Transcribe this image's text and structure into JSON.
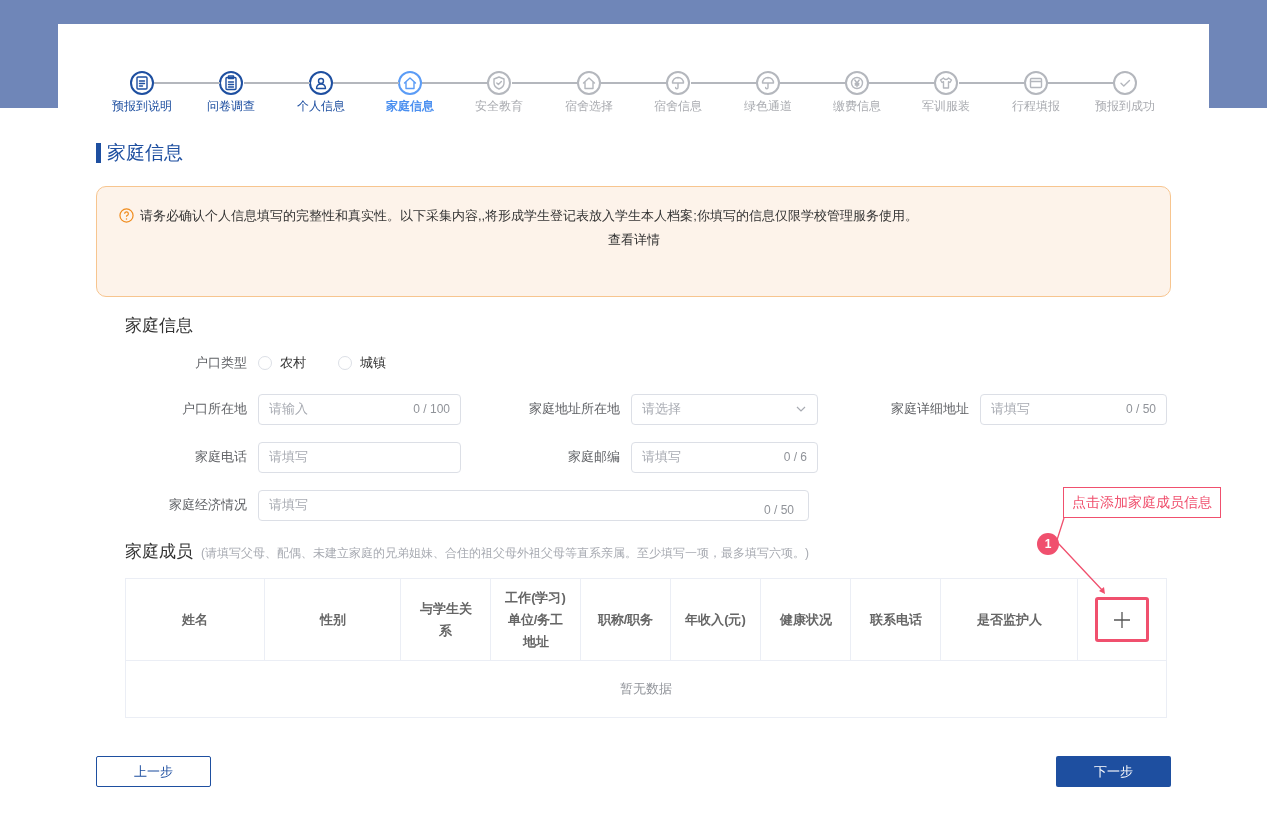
{
  "steps": [
    {
      "label": "预报到说明",
      "done": true,
      "selected": false,
      "kind": "document"
    },
    {
      "label": "问卷调查",
      "done": true,
      "selected": false,
      "kind": "clipboard"
    },
    {
      "label": "个人信息",
      "done": true,
      "selected": false,
      "kind": "person"
    },
    {
      "label": "家庭信息",
      "done": false,
      "selected": true,
      "kind": "home"
    },
    {
      "label": "安全教育",
      "done": false,
      "selected": false,
      "kind": "shield"
    },
    {
      "label": "宿舍选择",
      "done": false,
      "selected": false,
      "kind": "home"
    },
    {
      "label": "宿舍信息",
      "done": false,
      "selected": false,
      "kind": "umbrella"
    },
    {
      "label": "绿色通道",
      "done": false,
      "selected": false,
      "kind": "umbrella"
    },
    {
      "label": "缴费信息",
      "done": false,
      "selected": false,
      "kind": "yen"
    },
    {
      "label": "军训服装",
      "done": false,
      "selected": false,
      "kind": "shirt"
    },
    {
      "label": "行程填报",
      "done": false,
      "selected": false,
      "kind": "card"
    },
    {
      "label": "预报到成功",
      "done": false,
      "selected": false,
      "kind": "check"
    }
  ],
  "page_title": "家庭信息",
  "notice": {
    "text": "请务必确认个人信息填写的完整性和真实性。以下采集内容,,将形成学生登记表放入学生本人档案;你填写的信息仅限学校管理服务使用。",
    "link": "查看详情"
  },
  "section_title": "家庭信息",
  "household_type": {
    "label": "户口类型",
    "options": [
      {
        "label": "农村",
        "selected": false
      },
      {
        "label": "城镇",
        "selected": false
      }
    ]
  },
  "fields": [
    {
      "label": "户口所在地",
      "placeholder": "请输入",
      "counter": "0 / 100",
      "kind": "input"
    },
    {
      "label": "家庭地址所在地",
      "placeholder": "请选择",
      "kind": "select"
    },
    {
      "label": "家庭详细地址",
      "placeholder": "请填写",
      "counter": "0 / 50",
      "kind": "input"
    },
    {
      "label": "家庭电话",
      "placeholder": "请填写",
      "kind": "input"
    },
    {
      "label": "家庭邮编",
      "placeholder": "请填写",
      "counter": "0 / 6",
      "kind": "input"
    }
  ],
  "economy_field": {
    "label": "家庭经济情况",
    "placeholder": "请填写",
    "counter": "0 / 50"
  },
  "members": {
    "title": "家庭成员",
    "hint": "(请填写父母、配偶、未建立家庭的兄弟姐妹、合住的祖父母外祖父母等直系亲属。至少填写一项，最多填写六项。)",
    "columns": [
      "姓名",
      "性别",
      "与学生关系",
      "工作(学习)单位/务工地址",
      "职称/职务",
      "年收入(元)",
      "健康状况",
      "联系电话",
      "是否监护人"
    ],
    "empty_text": "暂无数据"
  },
  "annotation": {
    "callout": "点击添加家庭成员信息",
    "badge": "1"
  },
  "buttons": {
    "prev": "上一步",
    "next": "下一步"
  }
}
